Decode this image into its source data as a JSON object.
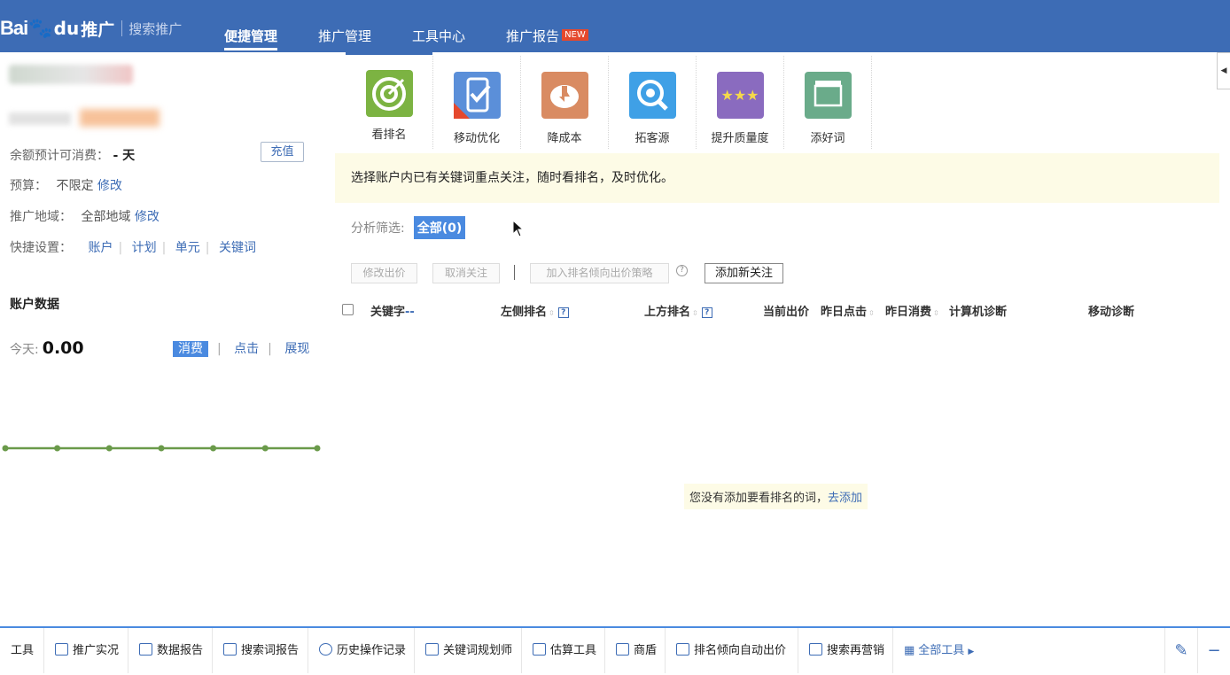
{
  "header": {
    "logo_bai": "Bai",
    "logo_du": "du",
    "logo_product": "推广",
    "logo_sub": "搜索推广",
    "nav": [
      {
        "label": "便捷管理",
        "active": true
      },
      {
        "label": "推广管理"
      },
      {
        "label": "工具中心"
      },
      {
        "label": "推广报告",
        "badge": "NEW"
      }
    ]
  },
  "left": {
    "balance_days_label": "余额预计可消费：",
    "balance_days_value": "- 天",
    "recharge_button": "充值",
    "budget_label": "预算：",
    "budget_value": "不限定",
    "budget_edit": "修改",
    "region_label": "推广地域：",
    "region_value": "全部地域",
    "region_edit": "修改",
    "quick_label": "快捷设置：",
    "quick_links": [
      "账户",
      "计划",
      "单元",
      "关键词"
    ],
    "account_data_title": "账户数据",
    "today_label": "今天:",
    "today_value": "0.00",
    "metrics": [
      "消费",
      "点击",
      "展现"
    ],
    "chart_color": "#6a9a4a"
  },
  "tools": [
    {
      "label": "看排名",
      "icon": "target-icon",
      "color": "#7cb342"
    },
    {
      "label": "移动优化",
      "icon": "phone-check-icon",
      "color": "#5b8fd9"
    },
    {
      "label": "降成本",
      "icon": "piggy-bank-icon",
      "color": "#d98b62"
    },
    {
      "label": "拓客源",
      "icon": "magnifier-icon",
      "color": "#3fa0e6"
    },
    {
      "label": "提升质量度",
      "icon": "stars-icon",
      "color": "#8a6bbf"
    },
    {
      "label": "添好词",
      "icon": "word-icon",
      "color": "#6aab8a"
    }
  ],
  "main": {
    "tip": "选择账户内已有关键词重点关注，随时看排名，及时优化。",
    "filter_label": "分析筛选:",
    "filter_all": "全部(0)",
    "actions": {
      "modify_bid": "修改出价",
      "unfollow": "取消关注",
      "add_strategy": "加入排名倾向出价策略",
      "add_follow": "添加新关注"
    },
    "columns": {
      "keyword": "关键字",
      "keyword_sort": "--",
      "left_rank": "左侧排名",
      "top_rank": "上方排名",
      "current_bid": "当前出价",
      "yesterday_clicks": "昨日点击",
      "yesterday_cost": "昨日消费",
      "pc_diag": "计算机诊断",
      "mobile_diag": "移动诊断"
    },
    "empty_text": "您没有添加要看排名的词，",
    "empty_link": "去添加"
  },
  "bottom": {
    "tools_label": "工具",
    "items": [
      "推广实况",
      "数据报告",
      "搜索词报告",
      "历史操作记录",
      "关键词规划师",
      "估算工具",
      "商盾",
      "排名倾向自动出价",
      "搜索再营销"
    ],
    "all_tools": "全部工具"
  }
}
